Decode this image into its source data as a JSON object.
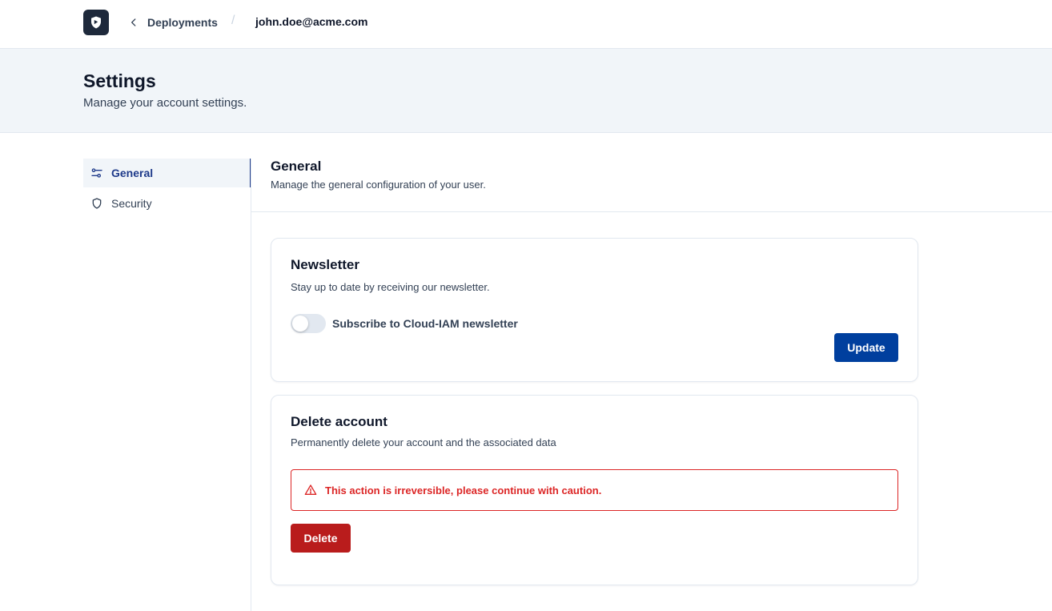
{
  "topbar": {
    "logo_icon": "shield-logo-icon",
    "back_icon": "chevron-left-icon",
    "back_label": "Deployments",
    "separator": "/",
    "current": "john.doe@acme.com"
  },
  "header": {
    "title": "Settings",
    "subtitle": "Manage your account settings."
  },
  "sidebar": {
    "items": [
      {
        "label": "General",
        "icon": "sliders-icon",
        "active": true
      },
      {
        "label": "Security",
        "icon": "shield-icon",
        "active": false
      }
    ]
  },
  "main": {
    "title": "General",
    "subtitle": "Manage the general configuration of your user.",
    "newsletter": {
      "title": "Newsletter",
      "subtitle": "Stay up to date by receiving our newsletter.",
      "toggle_label": "Subscribe to Cloud-IAM newsletter",
      "toggle_checked": false,
      "update_label": "Update"
    },
    "delete_account": {
      "title": "Delete account",
      "subtitle": "Permanently delete your account and the associated data",
      "alert_icon": "warning-triangle-icon",
      "alert_text": "This action is irreversible, please continue with caution.",
      "delete_label": "Delete"
    }
  },
  "colors": {
    "primary": "#003f9e",
    "danger": "#b91c1c",
    "alert_red": "#dc2626",
    "header_bg": "#f1f5f9"
  }
}
